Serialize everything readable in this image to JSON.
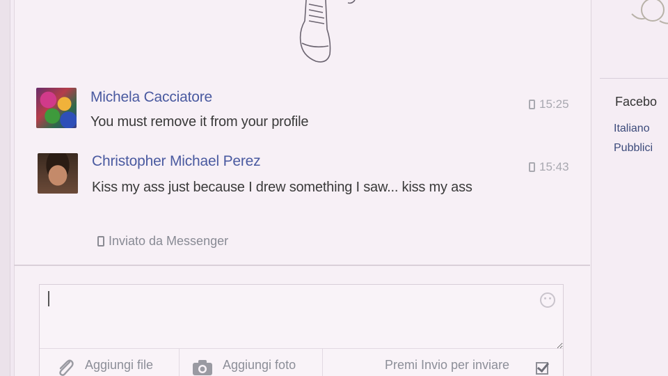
{
  "messages": [
    {
      "sender": "Michela Cacciatore",
      "text": "You must remove it from your profile",
      "time": "15:25"
    },
    {
      "sender": "Christopher Michael Perez",
      "text": "Kiss my ass just because I drew something I saw... kiss my ass",
      "time": "15:43"
    }
  ],
  "sent_via": "Inviato da Messenger",
  "composer": {
    "value": "",
    "add_file_label": "Aggiungi file",
    "add_photo_label": "Aggiungi foto",
    "enter_to_send_label": "Premi Invio per inviare",
    "enter_to_send_checked": true
  },
  "right_sidebar": {
    "title": "Facebo",
    "links": [
      "Italiano",
      "Pubblici"
    ]
  },
  "colors": {
    "name_link": "#4a5aa0",
    "background": "#f7f0f6"
  },
  "icons": {
    "phone": "phone-icon",
    "emoji": "emoji-icon",
    "attach": "paperclip-icon",
    "photo": "camera-icon"
  }
}
